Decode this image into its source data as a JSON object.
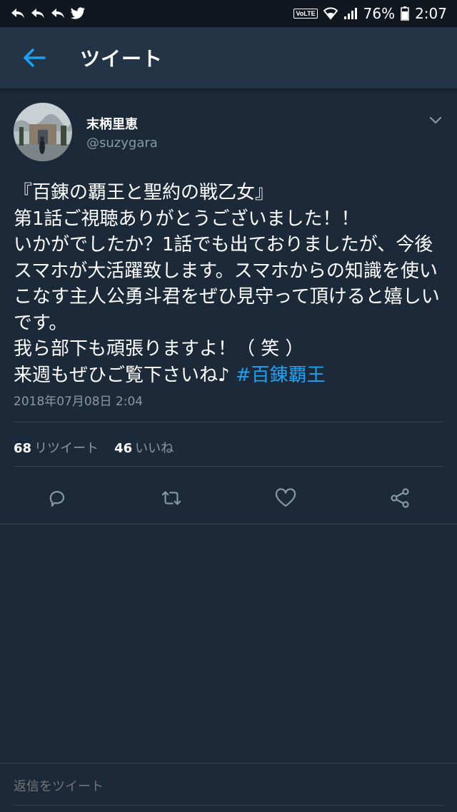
{
  "status_bar": {
    "left_icons": [
      "reply-arrow-icon",
      "reply-arrow-icon",
      "reply-arrow-icon",
      "twitter-bird-icon"
    ],
    "volte": "VoLTE",
    "battery_percent": "76%",
    "time": "2:07"
  },
  "appbar": {
    "title": "ツイート"
  },
  "tweet": {
    "author_name": "末柄里恵",
    "author_handle": "@suzygara",
    "text": "『百錬の覇王と聖約の戦乙女』\n第1話ご視聴ありがとうございました！！\nいかがでしたか？1話でも出ておりましたが、今後スマホが大活躍致します。スマホからの知識を使いこなす主人公勇斗君をぜひ見守って頂けると嬉しいです。\n我ら部下も頑張りますよ！（ 笑 ）\n来週もぜひご覧下さいね♪ ",
    "hashtag": "#百錬覇王",
    "timestamp": "2018年07月08日 2:04",
    "retweet_count": "68",
    "retweet_label": "リツイート",
    "like_count": "46",
    "like_label": "いいね"
  },
  "reply": {
    "placeholder": "返信をツイート"
  },
  "colors": {
    "background": "#1c2938",
    "appbar": "#243447",
    "accent": "#1da1f2",
    "secondary_text": "#8899a6"
  }
}
